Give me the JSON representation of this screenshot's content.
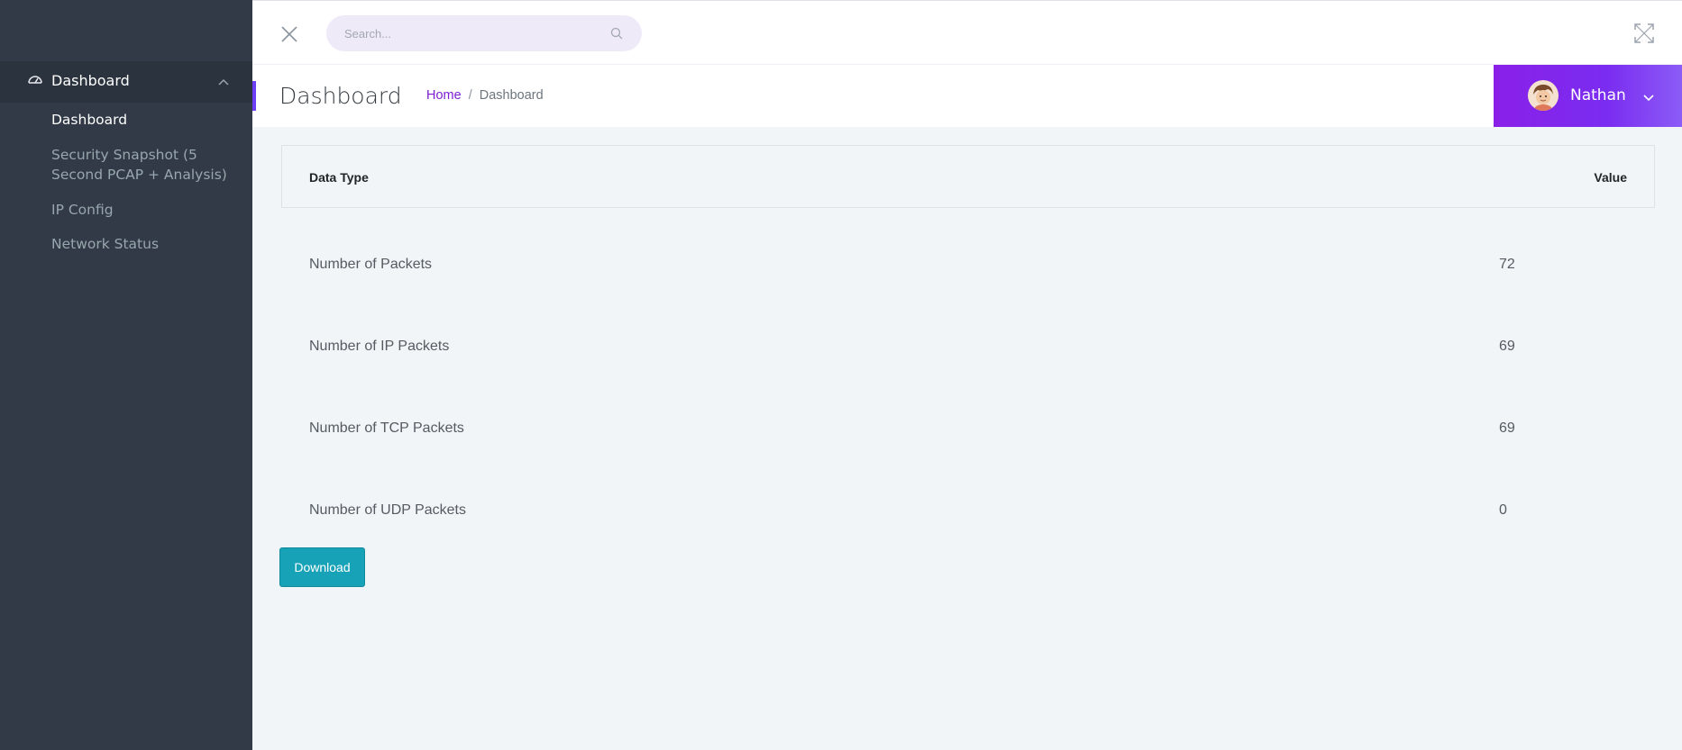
{
  "sidebar": {
    "group": {
      "label": "Dashboard",
      "icon": "dashboard-gauge-icon"
    },
    "items": [
      {
        "label": "Dashboard",
        "active": true
      },
      {
        "label": "Security Snapshot (5 Second PCAP + Analysis)",
        "active": false
      },
      {
        "label": "IP Config",
        "active": false
      },
      {
        "label": "Network Status",
        "active": false
      }
    ]
  },
  "topbar": {
    "search_placeholder": "Search...",
    "search_value": ""
  },
  "header": {
    "title": "Dashboard",
    "breadcrumb": {
      "home": "Home",
      "separator": "/",
      "current": "Dashboard"
    }
  },
  "user": {
    "name": "Nathan"
  },
  "table": {
    "columns": {
      "data_type": "Data Type",
      "value": "Value"
    },
    "rows": [
      {
        "label": "Number of Packets",
        "value": "72"
      },
      {
        "label": "Number of IP Packets",
        "value": "69"
      },
      {
        "label": "Number of TCP Packets",
        "value": "69"
      },
      {
        "label": "Number of UDP Packets",
        "value": "0"
      }
    ]
  },
  "actions": {
    "download_label": "Download"
  },
  "colors": {
    "sidebar_bg": "#313a46",
    "accent": "#7b1fd1",
    "user_menu_gradient_start": "#8a20e8",
    "download_button": "#17a2b8",
    "page_bg": "#f1f5f8"
  }
}
